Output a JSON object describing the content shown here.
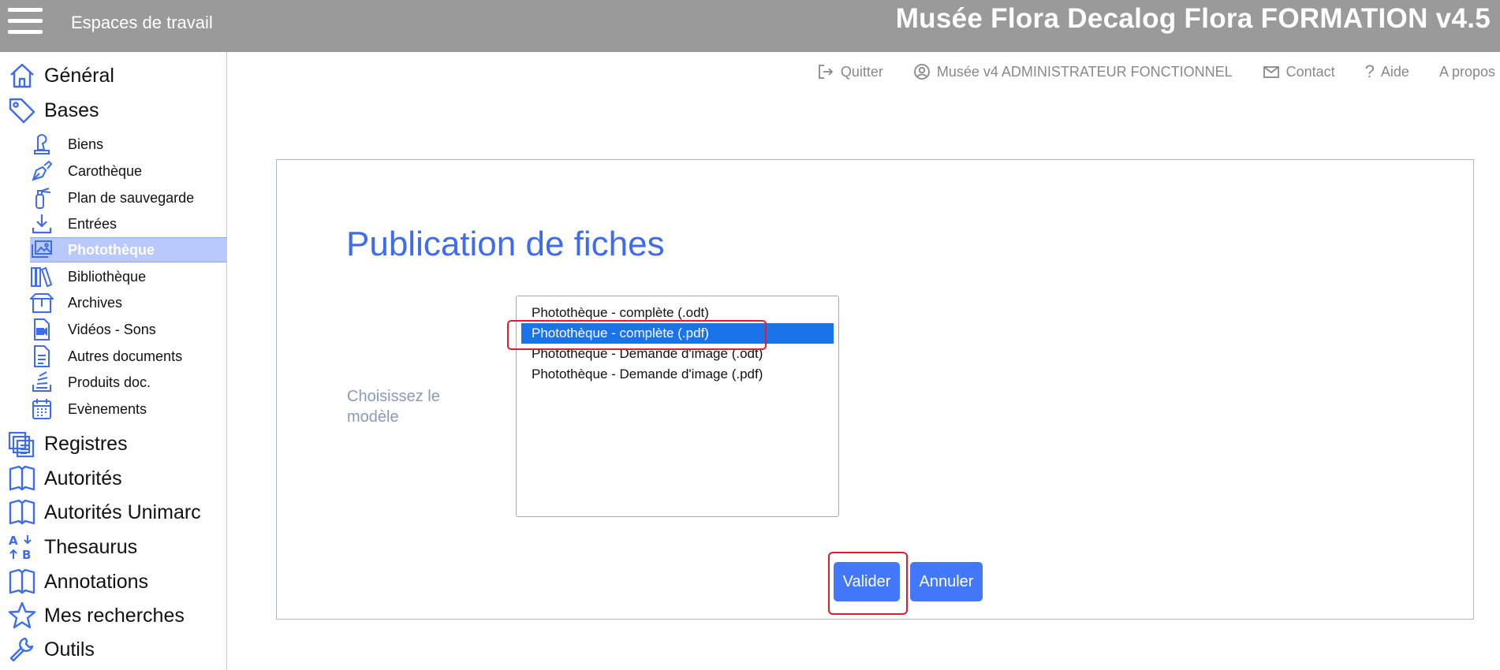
{
  "header": {
    "workspaces_label": "Espaces de travail",
    "app_title": "Musée Flora Decalog Flora FORMATION v4.5"
  },
  "sidebar": {
    "main_items": [
      {
        "label": "Général",
        "icon": "home-icon"
      },
      {
        "label": "Bases",
        "icon": "tag-icon"
      },
      {
        "label": "Registres",
        "icon": "registers-icon"
      },
      {
        "label": "Autorités",
        "icon": "book-icon"
      },
      {
        "label": "Autorités Unimarc",
        "icon": "book-icon"
      },
      {
        "label": "Thesaurus",
        "icon": "thesaurus-icon"
      },
      {
        "label": "Annotations",
        "icon": "book-icon"
      },
      {
        "label": "Mes recherches",
        "icon": "star-icon"
      },
      {
        "label": "Outils",
        "icon": "wrench-icon"
      }
    ],
    "sub_items": [
      {
        "label": "Biens",
        "icon": "chess-piece-icon"
      },
      {
        "label": "Carothèque",
        "icon": "pen-nib-icon"
      },
      {
        "label": "Plan de sauvegarde",
        "icon": "fire-extinguisher-icon"
      },
      {
        "label": "Entrées",
        "icon": "download-icon"
      },
      {
        "label": "Photothèque",
        "icon": "images-icon",
        "active": true
      },
      {
        "label": "Bibliothèque",
        "icon": "books-icon"
      },
      {
        "label": "Archives",
        "icon": "box-icon"
      },
      {
        "label": "Vidéos - Sons",
        "icon": "video-file-icon"
      },
      {
        "label": "Autres documents",
        "icon": "document-icon"
      },
      {
        "label": "Produits doc.",
        "icon": "stack-icon"
      },
      {
        "label": "Evènements",
        "icon": "calendar-icon"
      }
    ]
  },
  "utility_bar": {
    "quit": "Quitter",
    "user": "Musée v4 ADMINISTRATEUR FONCTIONNEL",
    "contact": "Contact",
    "help": "Aide",
    "about": "A propos"
  },
  "main": {
    "title": "Publication de fiches",
    "choose_label": "Choisissez le modèle",
    "options": [
      "Photothèque - complète (.odt)",
      "Photothèque - complète (.pdf)",
      "Photothèque - Demande d'image (.odt)",
      "Photothèque - Demande d'image (.pdf)"
    ],
    "selected_index": 1,
    "validate_label": "Valider",
    "cancel_label": "Annuler"
  },
  "colors": {
    "accent": "#4478fb",
    "title_blue": "#3d6cf0",
    "header_gray": "#9a9a9a",
    "highlight_red": "#e31b2e",
    "selected_option": "#1a73e8"
  }
}
